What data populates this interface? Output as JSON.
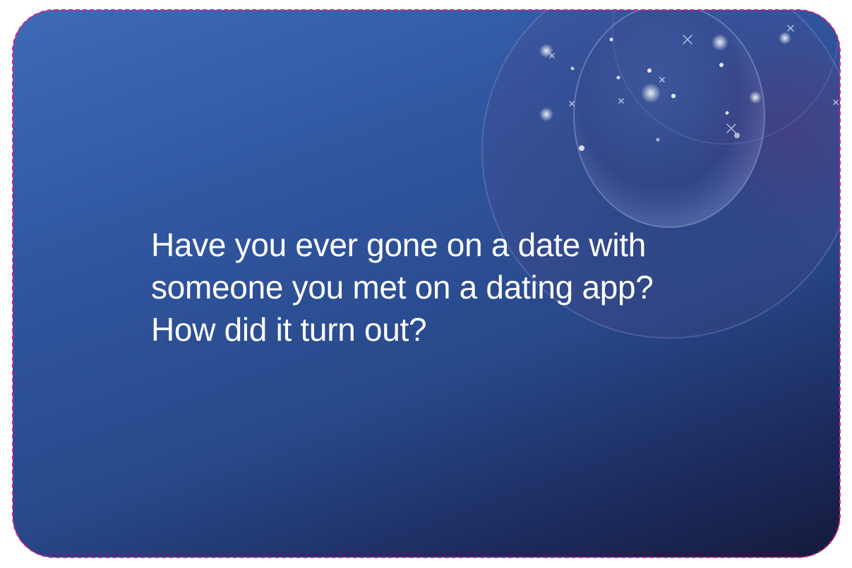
{
  "card": {
    "question": "Have you ever gone on a date with\nsomeone you met on a dating app?\nHow did it turn out?",
    "background_colors": [
      "#3e6ab8",
      "#284889",
      "#151a3a"
    ],
    "cut_line_color": "#e0218a",
    "text_color": "#ffffff"
  }
}
